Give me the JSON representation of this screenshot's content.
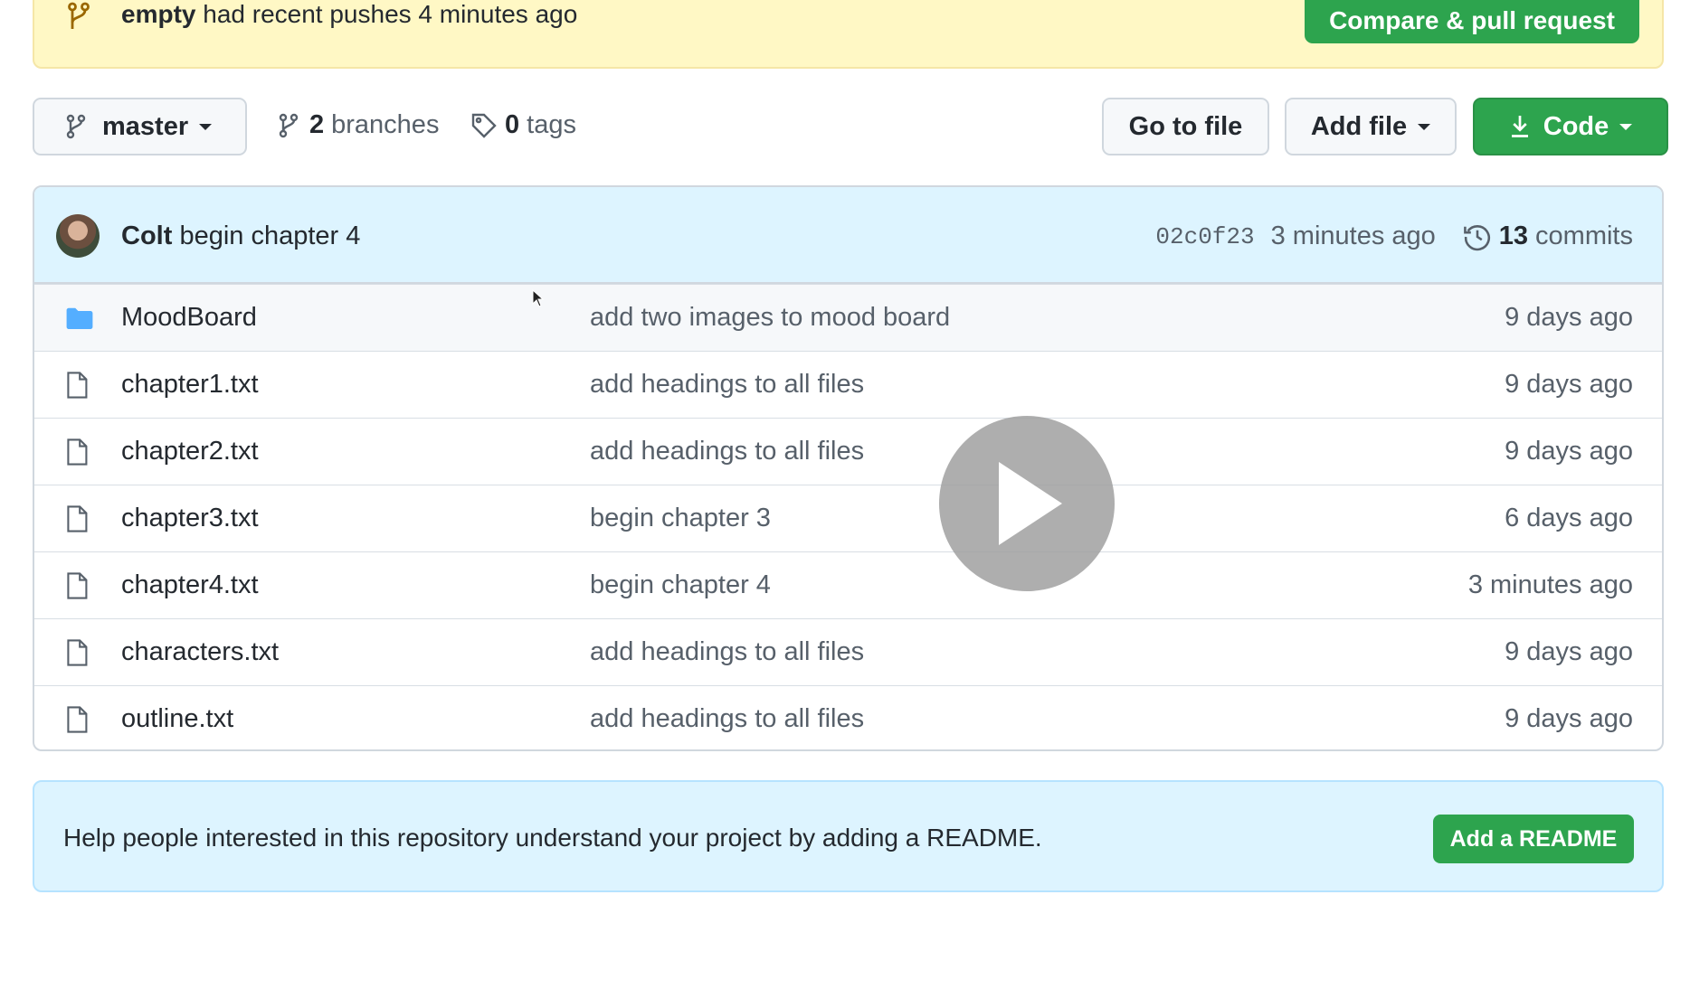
{
  "banner": {
    "branch": "empty",
    "message": "had recent pushes 4 minutes ago",
    "compare_button": "Compare & pull request"
  },
  "toolbar": {
    "branch_name": "master",
    "branches_count": "2",
    "branches_label": "branches",
    "tags_count": "0",
    "tags_label": "tags",
    "goto_file": "Go to file",
    "add_file": "Add file",
    "code": "Code"
  },
  "latest_commit": {
    "author": "Colt",
    "message": "begin chapter 4",
    "sha": "02c0f23",
    "time": "3 minutes ago",
    "commits_count": "13",
    "commits_label": "commits"
  },
  "files": [
    {
      "icon": "folder-icon",
      "name": "MoodBoard",
      "commit": "add two images to mood board",
      "date": "9 days ago"
    },
    {
      "icon": "file-icon",
      "name": "chapter1.txt",
      "commit": "add headings to all files",
      "date": "9 days ago"
    },
    {
      "icon": "file-icon",
      "name": "chapter2.txt",
      "commit": "add headings to all files",
      "date": "9 days ago"
    },
    {
      "icon": "file-icon",
      "name": "chapter3.txt",
      "commit": "begin chapter 3",
      "date": "6 days ago"
    },
    {
      "icon": "file-icon",
      "name": "chapter4.txt",
      "commit": "begin chapter 4",
      "date": "3 minutes ago"
    },
    {
      "icon": "file-icon",
      "name": "characters.txt",
      "commit": "add headings to all files",
      "date": "9 days ago"
    },
    {
      "icon": "file-icon",
      "name": "outline.txt",
      "commit": "add headings to all files",
      "date": "9 days ago"
    }
  ],
  "readme": {
    "message": "Help people interested in this repository understand your project by adding a README.",
    "button": "Add a README"
  },
  "colors": {
    "primary_green": "#2da44e",
    "banner_yellow": "#fff8c5",
    "info_blue": "#ddf4ff",
    "folder_blue": "#54aeff"
  }
}
